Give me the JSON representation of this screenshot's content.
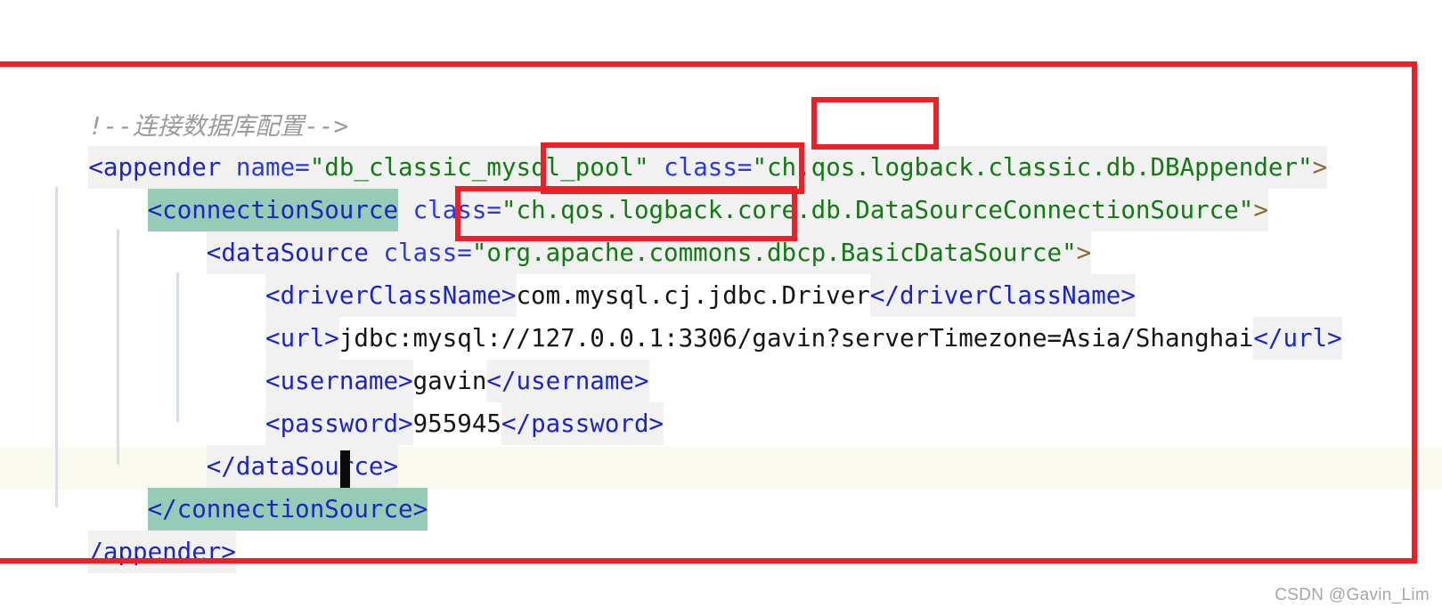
{
  "editor": {
    "language": "XML",
    "caret_line_index": 8,
    "colors": {
      "background": "#ffffff",
      "token_background": "#f1f1f1",
      "text_background": "#ffffff",
      "current_line": "#fbfaee",
      "bracket_match": "#96ccb6",
      "indent_guide": "#d8dee9",
      "caret": "#0b0b0b",
      "comment": "#9a9a9a",
      "bracket": "#8a6a2f",
      "tag_name": "#1c24c4",
      "attribute_name": "#2b3ae0",
      "string_value": "#127a12",
      "element_text": "#151515",
      "annotation_red": "#ee2026",
      "watermark": "#a6a6a6"
    },
    "lines": [
      {
        "index": 0,
        "plain": "<!--连接数据库配置-->",
        "clipped_left": true,
        "tokens": [
          {
            "text": "!--连接数据库配置-->",
            "kind": "comment"
          }
        ]
      },
      {
        "index": 1,
        "plain": "<appender name=\"db_classic_mysql_pool\" class=\"ch.qos.logback.classic.db.DBAppender\">",
        "clipped_left": true,
        "tokens": [
          {
            "text": "<appender",
            "kind": "tag"
          },
          {
            "text": " ",
            "kind": "space"
          },
          {
            "text": "name=",
            "kind": "attr"
          },
          {
            "text": "\"db_classic_mysql_pool\"",
            "kind": "str"
          },
          {
            "text": " ",
            "kind": "space"
          },
          {
            "text": "class=",
            "kind": "attr"
          },
          {
            "text": "\"ch.qos.logback.classic.db.DBAppender\"",
            "kind": "str"
          },
          {
            "text": ">",
            "kind": "bracket"
          }
        ]
      },
      {
        "index": 2,
        "plain": "    <connectionSource class=\"ch.qos.logback.core.db.DataSourceConnectionSource\">",
        "clipped_left": false,
        "bracket_matched": true,
        "tokens": [
          {
            "text": "<connectionSource",
            "kind": "tag",
            "matched": true
          },
          {
            "text": " ",
            "kind": "space"
          },
          {
            "text": "class=",
            "kind": "attr"
          },
          {
            "text": "\"ch.qos.logback.core.db.DataSourceConnectionSource\"",
            "kind": "str"
          },
          {
            "text": ">",
            "kind": "bracket"
          }
        ]
      },
      {
        "index": 3,
        "plain": "        <dataSource class=\"org.apache.commons.dbcp.BasicDataSource\">",
        "clipped_left": false,
        "tokens": [
          {
            "text": "<dataSource",
            "kind": "tag"
          },
          {
            "text": " ",
            "kind": "space"
          },
          {
            "text": "class=",
            "kind": "attr"
          },
          {
            "text": "\"org.apache.commons.dbcp.BasicDataSource\"",
            "kind": "str"
          },
          {
            "text": ">",
            "kind": "bracket"
          }
        ]
      },
      {
        "index": 4,
        "plain": "            <driverClassName>com.mysql.cj.jdbc.Driver</driverClassName>",
        "clipped_left": false,
        "tokens": [
          {
            "text": "<driverClassName>",
            "kind": "tag"
          },
          {
            "text": "com.mysql.cj.jdbc.Driver",
            "kind": "text"
          },
          {
            "text": "</driverClassName>",
            "kind": "tag"
          }
        ]
      },
      {
        "index": 5,
        "plain": "            <url>jdbc:mysql://127.0.0.1:3306/gavin?serverTimezone=Asia/Shanghai</url>",
        "clipped_left": false,
        "tokens": [
          {
            "text": "<url>",
            "kind": "tag"
          },
          {
            "text": "jdbc:mysql://127.0.0.1:3306/gavin?serverTimezone=Asia/Shanghai",
            "kind": "text"
          },
          {
            "text": "</url>",
            "kind": "tag"
          }
        ]
      },
      {
        "index": 6,
        "plain": "            <username>gavin</username>",
        "clipped_left": false,
        "tokens": [
          {
            "text": "<username>",
            "kind": "tag"
          },
          {
            "text": "gavin",
            "kind": "text"
          },
          {
            "text": "</username>",
            "kind": "tag"
          }
        ]
      },
      {
        "index": 7,
        "plain": "            <password>955945</password>",
        "clipped_left": false,
        "tokens": [
          {
            "text": "<password>",
            "kind": "tag"
          },
          {
            "text": "955945",
            "kind": "text"
          },
          {
            "text": "</password>",
            "kind": "tag"
          }
        ]
      },
      {
        "index": 8,
        "plain": "        </dataSource>",
        "clipped_left": false,
        "tokens": [
          {
            "text": "</dataSource>",
            "kind": "tag"
          }
        ]
      },
      {
        "index": 9,
        "plain": "    </connectionSource>",
        "clipped_left": false,
        "current_line": true,
        "bracket_matched": true,
        "tokens": [
          {
            "text": "</connectionSource>",
            "kind": "tag",
            "matched": true
          }
        ]
      },
      {
        "index": 10,
        "plain": "</appender>",
        "clipped_left": true,
        "tokens": [
          {
            "text": "/appender>",
            "kind": "tag"
          }
        ]
      }
    ]
  },
  "annotations": {
    "outer_box": {
      "label": "whole-snippet-outline",
      "color": "#ee2026"
    },
    "highlight_boxes": [
      {
        "label": "logback-package-classic",
        "text": "logback."
      },
      {
        "label": "logback-package-core",
        "text": "logback.core.db."
      },
      {
        "label": "apache-commons-dbcp-package",
        "text": ".apache.commons.dbcp."
      }
    ]
  },
  "watermark": {
    "text": "CSDN @Gavin_Lim"
  }
}
